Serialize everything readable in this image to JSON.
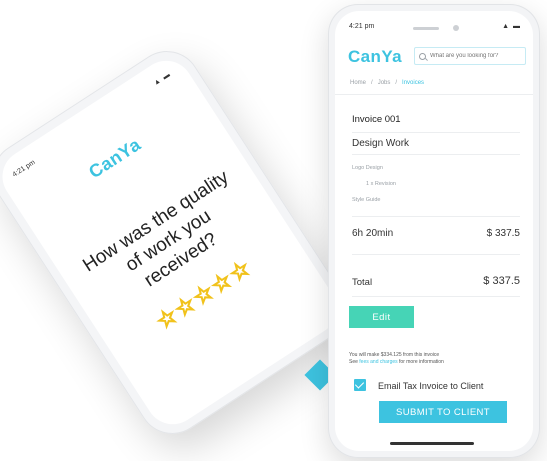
{
  "back_phone": {
    "time": "4:21 pm",
    "status": "▲ ▬",
    "logo": "CanYa",
    "question": "How was the quality of work you received?",
    "stars": [
      "☆",
      "☆",
      "☆",
      "☆",
      "☆"
    ]
  },
  "front_phone": {
    "status": {
      "time": "4:21 pm",
      "icons": "▲ ▬"
    },
    "logo": "CanYa",
    "search": {
      "placeholder": "What are you looking for?"
    },
    "breadcrumb": [
      "Home",
      "Jobs",
      "Invoices"
    ],
    "invoice": {
      "title": "Invoice 001",
      "subtitle": "Design Work",
      "items": [
        "Logo Design",
        "1 x Revision",
        "Style Guide"
      ],
      "hours": "6h 20min",
      "hours_amount": "$  337.5",
      "total_label": "Total",
      "total_amount": "$  337.5"
    },
    "edit_label": "Edit",
    "note": {
      "text": "You will make $334.125 from this invoice",
      "prefix": "See ",
      "link": "fees and charges",
      "suffix": " for more information"
    },
    "email_checkbox": {
      "checked": true,
      "label": "Email Tax Invoice to Client"
    },
    "submit_label": "SUBMIT TO CLIENT"
  },
  "colors": {
    "accent": "#3dc3e0",
    "edit": "#46d4b6",
    "star": "#f1c21b"
  }
}
